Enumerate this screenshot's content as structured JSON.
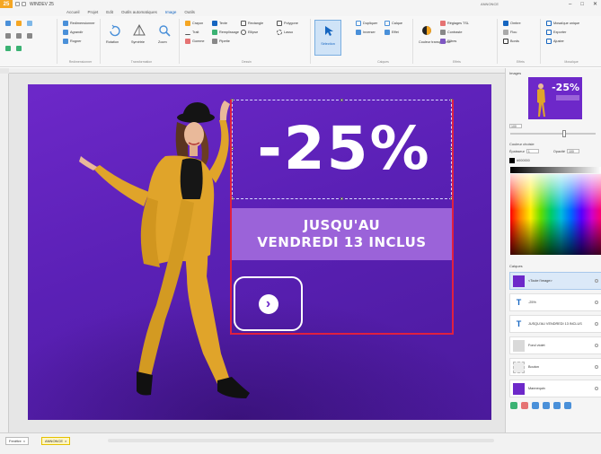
{
  "window": {
    "app_name": "WINDEV 25",
    "doc_title": "ANNONCE",
    "controls": [
      "–",
      "□",
      "✕"
    ]
  },
  "menu": {
    "tabs": [
      "Accueil",
      "Projet",
      "Edit",
      "Outils automatiques",
      "Image",
      "Outils"
    ],
    "active": "Image"
  },
  "ribbon": {
    "group1_items": [
      "Redimensionner",
      "Agrandir",
      "Rogner"
    ],
    "group2_items": [
      "Rotation",
      "Symétrie",
      "Zoom"
    ],
    "group3_items": [
      "Crayon",
      "Texte",
      "Rectangle",
      "Polygone",
      "Trait",
      "Remplissage",
      "Ellipse",
      "Lasso",
      "Gomme",
      "Pipette"
    ],
    "select_label": "Sélection",
    "group5_items": [
      "Dupliquer",
      "Calque",
      "Inverser",
      "Effet"
    ],
    "group6_items": [
      "Couleur transparente",
      "Réglages TSL",
      "Contraste",
      "Filtres"
    ],
    "group7_items": [
      "Ombre",
      "Flou",
      "Bords"
    ],
    "group8_items": [
      "Mosaïque unique",
      "Exporter",
      "Ajuster"
    ],
    "group_labels": [
      "Redimensionner",
      "Transformation",
      "Dessin",
      "Sélection",
      "Calques",
      "Effets",
      "Effets",
      "Mosaïque"
    ]
  },
  "canvas": {
    "discount": "-25%",
    "banner_line1": "JUSQU'AU",
    "banner_line2": "VENDREDI 13 INCLUS",
    "arrow_glyph": "›",
    "bg_color": "#6d28c9",
    "banner_color": "#9b63d9",
    "accent_red": "#e02040"
  },
  "panel": {
    "images_title": "Images",
    "thumb_text": "-25%",
    "zoom_value": "100",
    "color_title": "Couleur choisie",
    "thickness_label": "Épaisseur",
    "thickness_value": "1",
    "opacity_label": "Opacité",
    "opacity_value": "100",
    "hex_value": "#000000",
    "layers_title": "Calques",
    "layers": [
      {
        "name": "<Toute l'image>",
        "type": "image"
      },
      {
        "name": "-25%",
        "type": "text"
      },
      {
        "name": "JUSQU'AU VENDREDI 13 INCLUS",
        "type": "text"
      },
      {
        "name": "Fond violet",
        "type": "shape"
      },
      {
        "name": "Bouton",
        "type": "shape"
      },
      {
        "name": "Mannequin",
        "type": "image"
      }
    ]
  },
  "statusbar": {
    "tabs": [
      "Fenêtre",
      "ANNONCE"
    ]
  }
}
